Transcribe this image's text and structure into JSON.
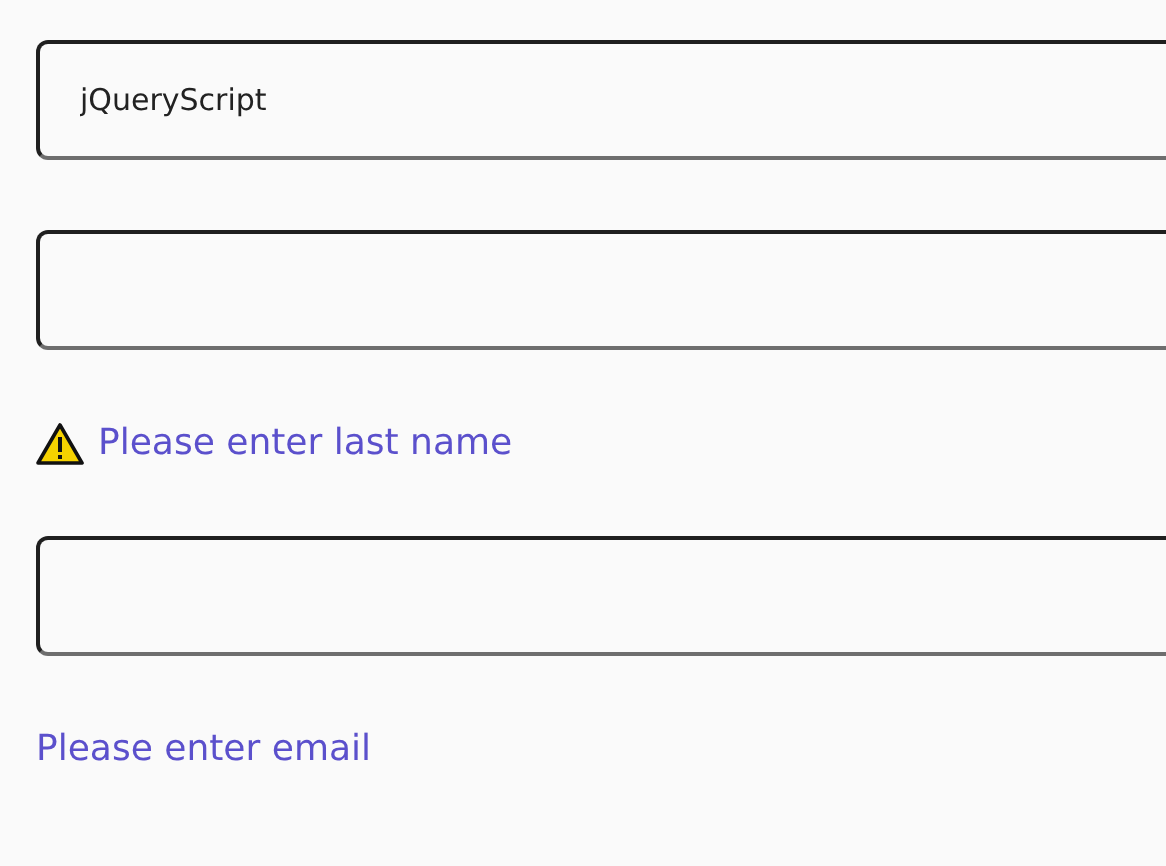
{
  "fields": [
    {
      "value": "jQueryScript"
    },
    {
      "error": {
        "text": "Please enter last name",
        "kind": "warning"
      }
    },
    {
      "error": {
        "text": "Please enter email",
        "kind": "plain"
      }
    }
  ]
}
